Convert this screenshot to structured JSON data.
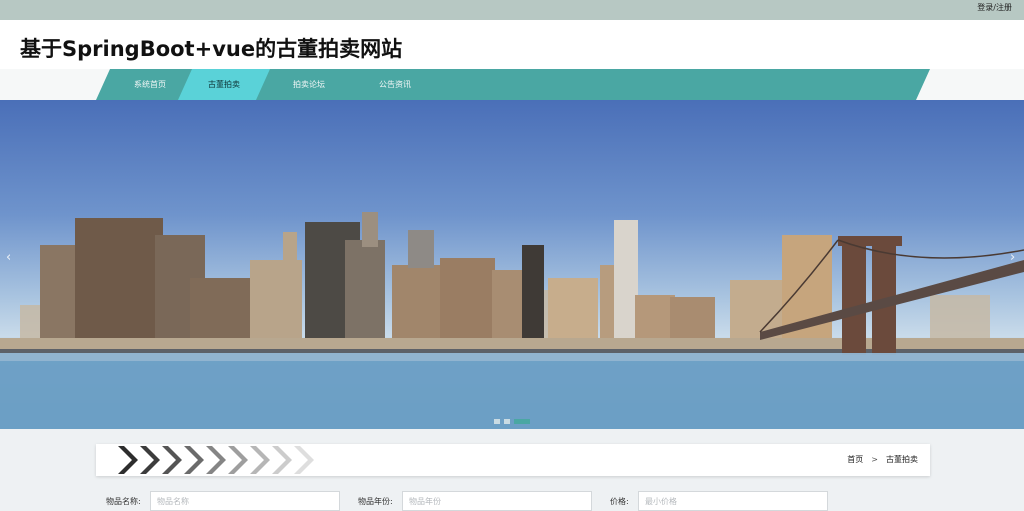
{
  "topbar": {
    "login_label": "登录/注册"
  },
  "header": {
    "title": "基于SpringBoot+vue的古董拍卖网站"
  },
  "nav": {
    "items": [
      {
        "label": "系统首页"
      },
      {
        "label": "古董拍卖"
      },
      {
        "label": "拍卖论坛"
      },
      {
        "label": "公告资讯"
      }
    ],
    "active_index": 1,
    "accent_color": "#4aa7a3",
    "active_color": "#5ad2d8"
  },
  "banner": {
    "prev_icon": "chevron-left-icon",
    "next_icon": "chevron-right-icon",
    "slide_count": 3,
    "active_slide": 3
  },
  "breadcrumb": {
    "home": "首页",
    "separator": ">",
    "current": "古董拍卖"
  },
  "search": {
    "name_label": "物品名称:",
    "name_placeholder": "物品名称",
    "age_label": "物品年份:",
    "age_placeholder": "物品年份",
    "price_label": "价格:",
    "price_placeholder": "最小价格"
  }
}
